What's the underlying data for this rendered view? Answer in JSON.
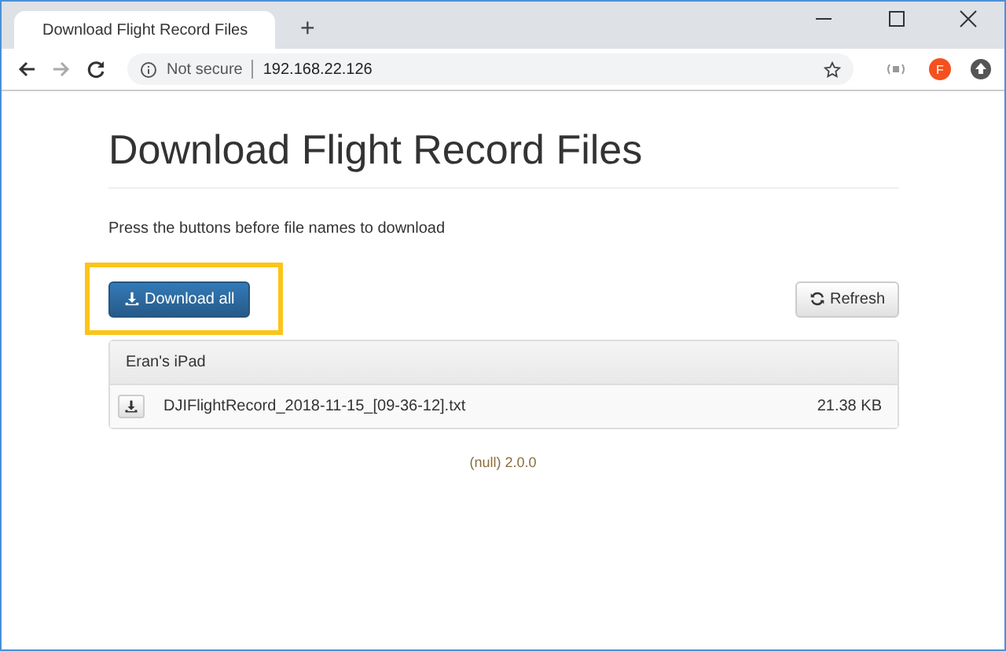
{
  "browser": {
    "tab_title": "Download Flight Record Files",
    "new_tab": "+",
    "address_security": "Not secure",
    "address": "192.168.22.126",
    "profile_initial": "F"
  },
  "page": {
    "heading": "Download Flight Record Files",
    "instructions": "Press the buttons before file names to download",
    "download_all": "Download all",
    "refresh": "Refresh",
    "device": {
      "name": "Eran's iPad",
      "files": [
        {
          "name": "DJIFlightRecord_2018-11-15_[09-36-12].txt",
          "size": "21.38 KB"
        }
      ]
    },
    "footer": "(null) 2.0.0"
  }
}
